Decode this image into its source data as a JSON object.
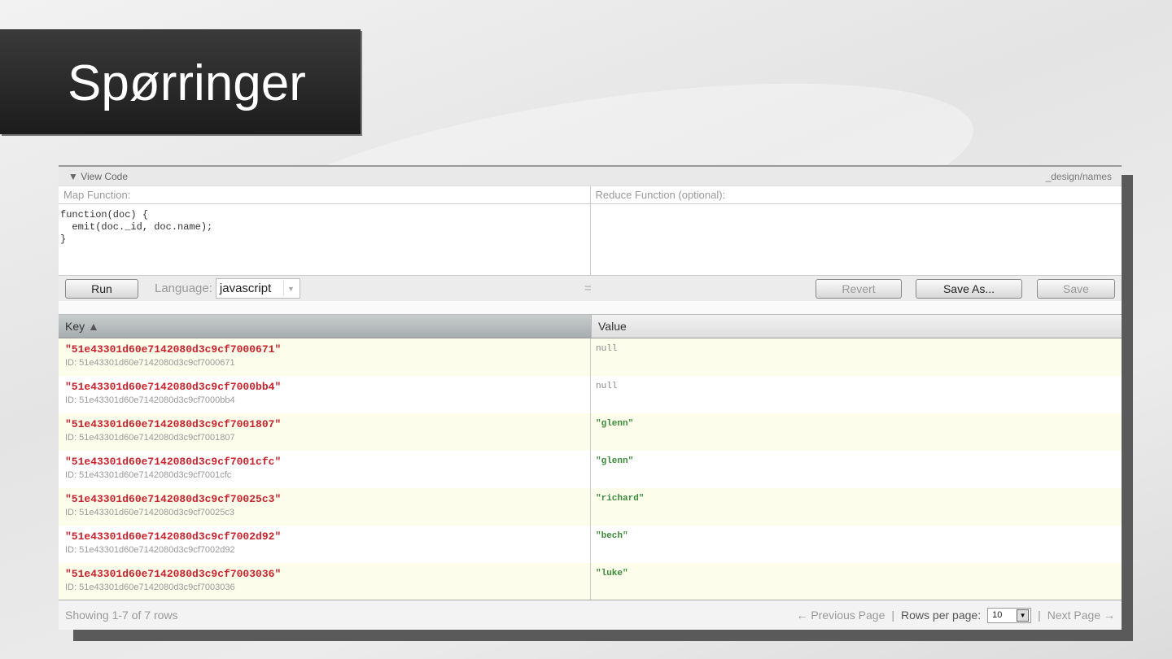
{
  "slide": {
    "title": "Spørringer"
  },
  "view_code": {
    "toggle": "▼ View Code",
    "design_doc": "_design/names"
  },
  "map": {
    "label": "Map Function:",
    "code": "function(doc) {\n  emit(doc._id, doc.name);\n}"
  },
  "reduce": {
    "label": "Reduce Function (optional):",
    "code": ""
  },
  "toolbar": {
    "run": "Run",
    "language_label": "Language:",
    "language": "javascript",
    "separator": "=",
    "revert": "Revert",
    "save_as": "Save As...",
    "save": "Save"
  },
  "table": {
    "headers": {
      "key": "Key",
      "value": "Value"
    },
    "rows": [
      {
        "key": "\"51e43301d60e7142080d3c9cf7000671\"",
        "id": "ID: 51e43301d60e7142080d3c9cf7000671",
        "value": "null"
      },
      {
        "key": "\"51e43301d60e7142080d3c9cf7000bb4\"",
        "id": "ID: 51e43301d60e7142080d3c9cf7000bb4",
        "value": "null"
      },
      {
        "key": "\"51e43301d60e7142080d3c9cf7001807\"",
        "id": "ID: 51e43301d60e7142080d3c9cf7001807",
        "value": "\"glenn\""
      },
      {
        "key": "\"51e43301d60e7142080d3c9cf7001cfc\"",
        "id": "ID: 51e43301d60e7142080d3c9cf7001cfc",
        "value": "\"glenn\""
      },
      {
        "key": "\"51e43301d60e7142080d3c9cf70025c3\"",
        "id": "ID: 51e43301d60e7142080d3c9cf70025c3",
        "value": "\"richard\""
      },
      {
        "key": "\"51e43301d60e7142080d3c9cf7002d92\"",
        "id": "ID: 51e43301d60e7142080d3c9cf7002d92",
        "value": "\"bech\""
      },
      {
        "key": "\"51e43301d60e7142080d3c9cf7003036\"",
        "id": "ID: 51e43301d60e7142080d3c9cf7003036",
        "value": "\"luke\""
      }
    ]
  },
  "footer": {
    "showing": "Showing 1-7 of 7 rows",
    "prev": "← Previous Page",
    "sep": "|",
    "rows_per_page_label": "Rows per page:",
    "rows_per_page": "10",
    "next": "Next Page →"
  }
}
